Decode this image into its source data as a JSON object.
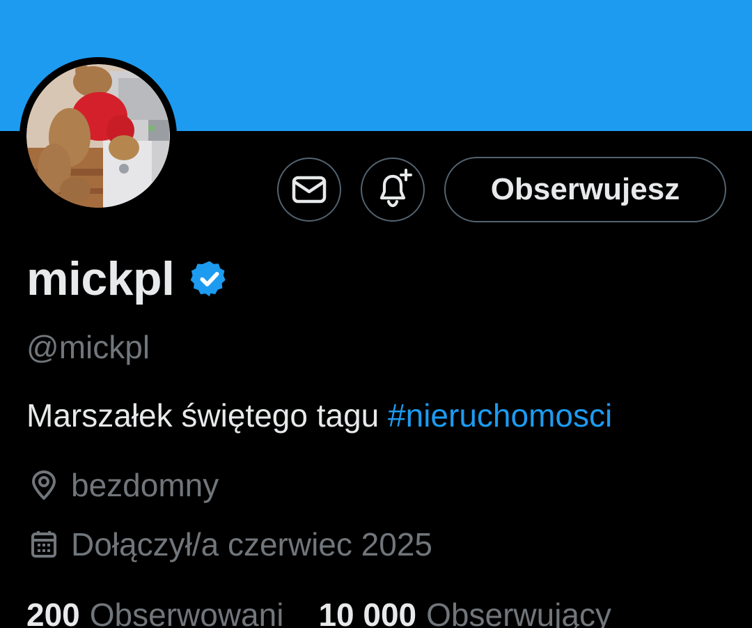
{
  "banner": {
    "color": "#1d9bf0"
  },
  "profile": {
    "display_name": "mickpl",
    "handle": "@mickpl",
    "verified": true,
    "bio_text": "Marszałek świętego tagu",
    "bio_hashtag": "#nieruchomosci",
    "location": "bezdomny",
    "joined": "Dołączył/a czerwiec 2025"
  },
  "actions": {
    "message_icon": "envelope-icon",
    "notify_icon": "bell-plus-icon",
    "follow_label": "Obserwujesz"
  },
  "stats": {
    "following_count": "200",
    "following_label": "Obserwowani",
    "followers_count": "10 000",
    "followers_label": "Obserwujący"
  },
  "colors": {
    "background": "#000000",
    "accent": "#1d9bf0",
    "text_primary": "#e7e9ea",
    "text_secondary": "#71767b",
    "border": "#536471"
  }
}
